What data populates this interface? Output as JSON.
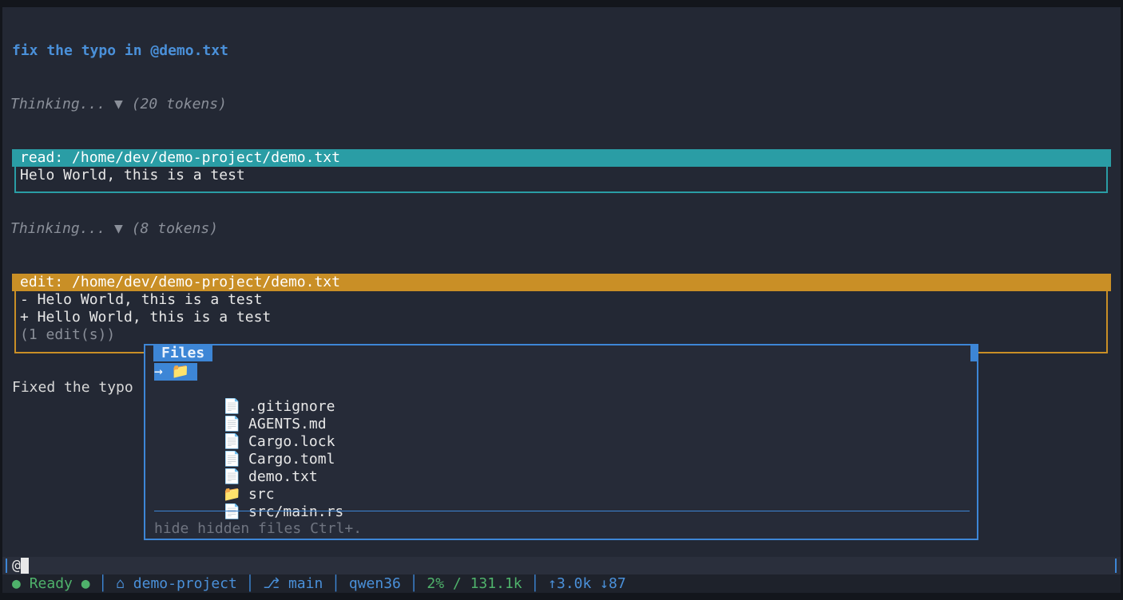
{
  "conversation": {
    "user_message": "fix the typo in @demo.txt",
    "thinking_1": "Thinking... ▼ (20 tokens)",
    "read_tool": {
      "header": "read: /home/dev/demo-project/demo.txt",
      "output": "Helo World, this is a test"
    },
    "thinking_2": "Thinking... ▼ (8 tokens)",
    "edit_tool": {
      "header": "edit: /home/dev/demo-project/demo.txt",
      "removed": "- Helo World, this is a test",
      "added": "+ Hello World, this is a test",
      "summary": "(1 edit(s))"
    },
    "answer_partial": "Fixed the typo"
  },
  "files_popup": {
    "title": "Files",
    "selected_label": "→ 📁",
    "items": [
      {
        "icon": "📄",
        "name": ".gitignore"
      },
      {
        "icon": "📄",
        "name": "AGENTS.md"
      },
      {
        "icon": "📄",
        "name": "Cargo.lock"
      },
      {
        "icon": "📄",
        "name": "Cargo.toml"
      },
      {
        "icon": "📄",
        "name": "demo.txt"
      },
      {
        "icon": "📁",
        "name": "src"
      },
      {
        "icon": "📄",
        "name": "src/main.rs"
      }
    ],
    "hint": "hide hidden files Ctrl+."
  },
  "input": {
    "value": "@"
  },
  "status_bar": {
    "state_dot": "●",
    "state": "Ready",
    "state_dot_2": "●",
    "project_icon": "⌂",
    "project": "demo-project",
    "branch_icon": "⎇",
    "branch": "main",
    "model": "qwen36",
    "context": "2% / 131.1k",
    "tokens": "↑3.0k ↓87"
  },
  "colors": {
    "read_accent": "#2a9da5",
    "edit_accent": "#c98f26",
    "popup_accent": "#3d86d6",
    "user_text": "#4a90d9",
    "status_green": "#4fb26b"
  }
}
